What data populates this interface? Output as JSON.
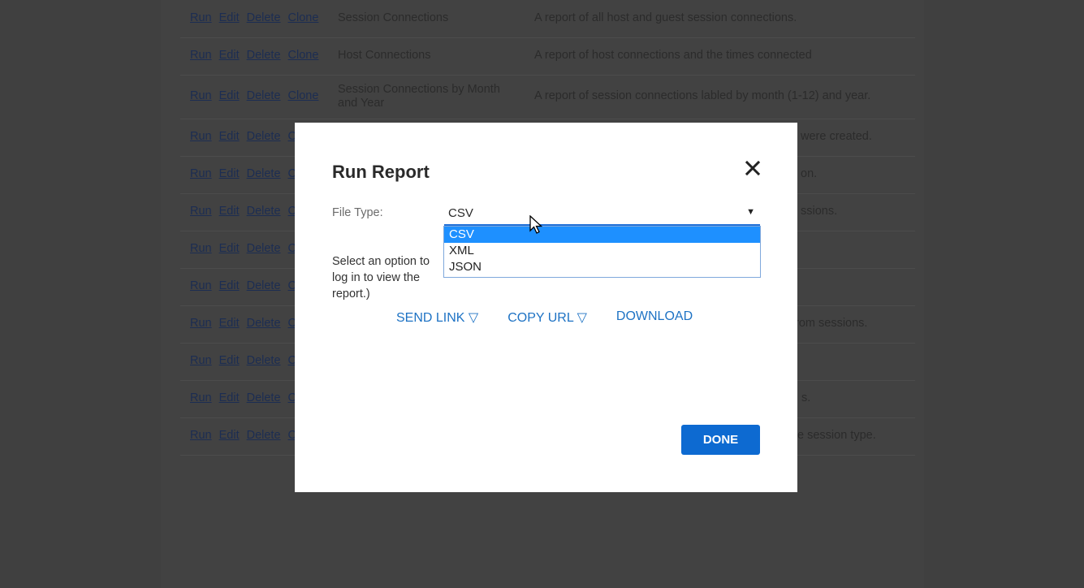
{
  "report_rows": [
    {
      "actions": [
        "Run",
        "Edit",
        "Delete",
        "Clone"
      ],
      "name": "Session Connections",
      "description": "A report of all host and guest session connections."
    },
    {
      "actions": [
        "Run",
        "Edit",
        "Delete",
        "Clone"
      ],
      "name": "Host Connections",
      "description": "A report of host connections and the times connected"
    },
    {
      "actions": [
        "Run",
        "Edit",
        "Delete",
        "Clone"
      ],
      "name": "Session Connections by Month and Year",
      "description": "A report of session connections labled by month (1-12) and year."
    },
    {
      "actions": [
        "Run",
        "Edit",
        "Delete",
        "C"
      ],
      "name": "",
      "description": "were created."
    },
    {
      "actions": [
        "Run",
        "Edit",
        "Delete",
        "C"
      ],
      "name": "",
      "description": "on."
    },
    {
      "actions": [
        "Run",
        "Edit",
        "Delete",
        "C"
      ],
      "name": "",
      "description": "ssions."
    },
    {
      "actions": [
        "Run",
        "Edit",
        "Delete",
        "C"
      ],
      "name": "",
      "description": ""
    },
    {
      "actions": [
        "Run",
        "Edit",
        "Delete",
        "C"
      ],
      "name": "",
      "description": ""
    },
    {
      "actions": [
        "Run",
        "Edit",
        "Delete",
        "C"
      ],
      "name": "",
      "description": "rom sessions."
    },
    {
      "actions": [
        "Run",
        "Edit",
        "Delete",
        "C"
      ],
      "name": "",
      "description": ""
    },
    {
      "actions": [
        "Run",
        "Edit",
        "Delete",
        "C"
      ],
      "name": "",
      "description": "s."
    },
    {
      "actions": [
        "Run",
        "Edit",
        "Delete",
        "C"
      ],
      "name": "",
      "description": "e session type."
    }
  ],
  "modal": {
    "title": "Run Report",
    "close_icon": "close-icon",
    "file_type_label": "File Type:",
    "selected_value": "CSV",
    "options": [
      "CSV",
      "XML",
      "JSON"
    ],
    "help_line1": "Select an option to",
    "help_line2": "log in to view the report.)",
    "actions": [
      "SEND LINK ▽",
      "COPY URL ▽",
      "DOWNLOAD"
    ],
    "done_label": "DONE"
  },
  "colors": {
    "accent": "#0d6ad1",
    "link": "#1d72c4",
    "selected_option": "#1e90ff"
  }
}
